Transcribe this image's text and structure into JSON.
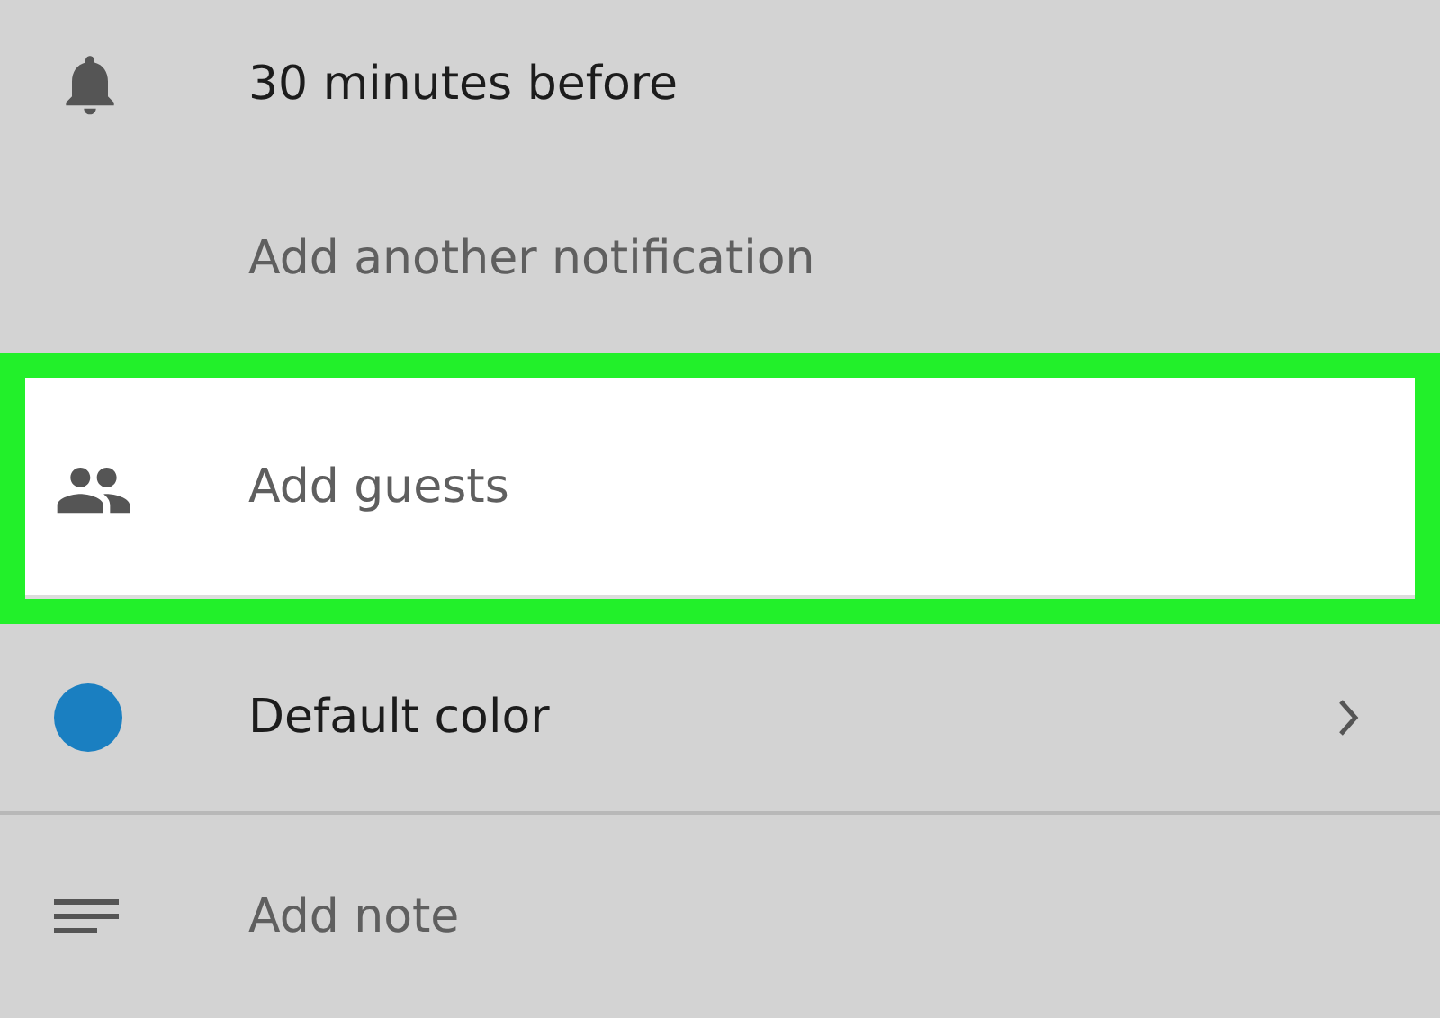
{
  "rows": [
    {
      "kind": "bell",
      "label": "30 minutes before",
      "muted": false,
      "highlighted": false,
      "chevron": false
    },
    {
      "kind": "plain",
      "label": "Add another notification",
      "muted": true,
      "highlighted": false,
      "chevron": false
    },
    {
      "kind": "people",
      "label": "Add guests",
      "muted": true,
      "highlighted": true,
      "chevron": false
    },
    {
      "kind": "color",
      "label": "Default color",
      "muted": false,
      "highlighted": false,
      "color": "#1a7fc1",
      "chevron": true
    },
    {
      "kind": "notes",
      "label": "Add note",
      "muted": true,
      "highlighted": false,
      "chevron": false
    }
  ]
}
